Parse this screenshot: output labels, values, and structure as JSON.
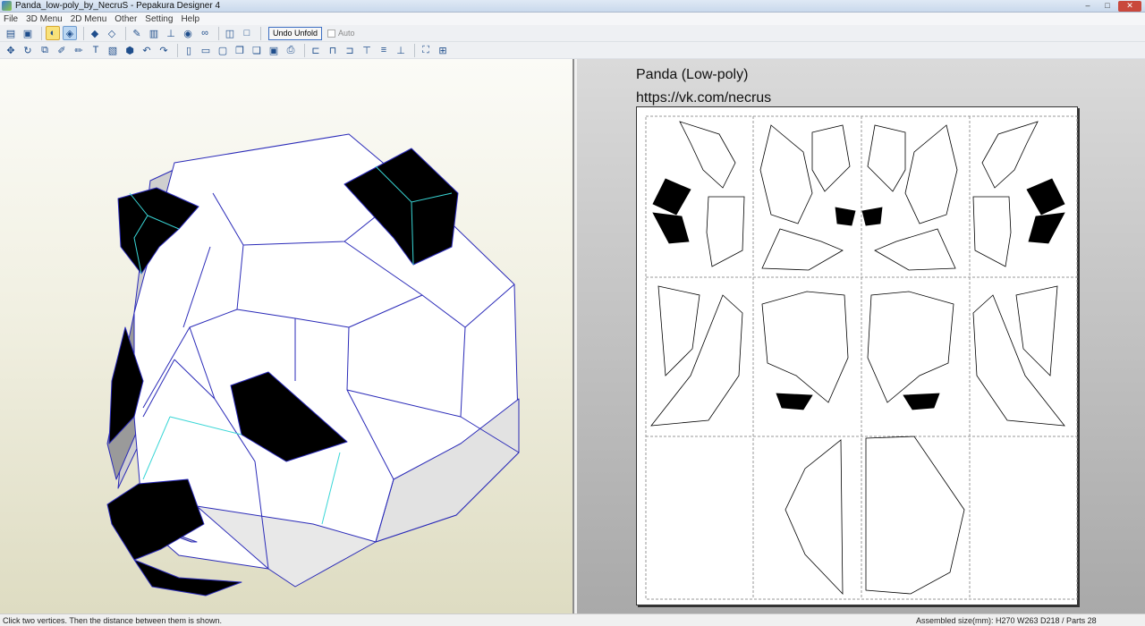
{
  "window": {
    "title": "Panda_low-poly_by_NecruS - Pepakura Designer 4",
    "controls": {
      "minimize": "–",
      "maximize": "□",
      "close": "✕"
    }
  },
  "menu": [
    "File",
    "3D Menu",
    "2D Menu",
    "Other",
    "Setting",
    "Help"
  ],
  "toolbar1": {
    "icons": [
      "open-icon",
      "save-icon",
      "bulb-icon",
      "unfold-icon",
      "cube-icon",
      "cube-alt-icon",
      "paint-icon",
      "cylinder-icon",
      "axis-icon",
      "eye-icon",
      "link-icon",
      "split-view-icon",
      "single-view-icon"
    ],
    "undo_unfold": "Undo Unfold",
    "auto_label": "Auto"
  },
  "toolbar2": {
    "icons": [
      "move-icon",
      "rotate-icon",
      "join-icon",
      "edit-line-icon",
      "edit-dash-icon",
      "text-icon",
      "image-icon",
      "box-icon",
      "undo-icon",
      "redo-icon",
      "book-icon",
      "book-open-icon",
      "page-icon",
      "page-copy-icon",
      "page-ref-icon",
      "disk-icon",
      "print-icon",
      "align-left-icon",
      "align-center-icon",
      "align-right-icon",
      "align-top-icon",
      "align-middle-icon",
      "align-bottom-icon",
      "fit-icon",
      "grid-icon"
    ]
  },
  "view2d": {
    "title": "Panda (Low-poly)",
    "url": "https://vk.com/necrus"
  },
  "status": {
    "left": "Click two vertices. Then the distance between them is shown.",
    "right": "Assembled size(mm): H270 W263 D218 / Parts 28"
  },
  "colors": {
    "edge_blue": "#2a2ab8",
    "edge_cyan": "#39d6d6",
    "face_black": "#000000",
    "face_white": "#ffffff",
    "face_gray": "#d6d6d6"
  }
}
